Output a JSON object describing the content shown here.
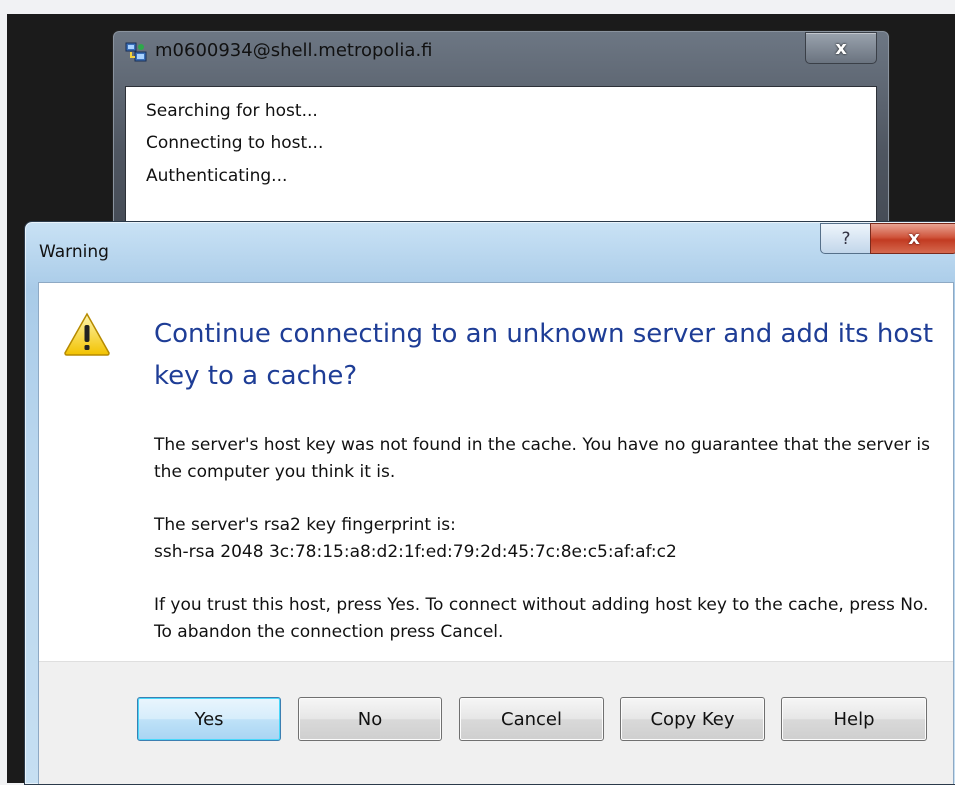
{
  "background_window": {
    "title": "m0600934@shell.metropolia.fi",
    "close_label": "x",
    "icon": "putty-icon",
    "lines": [
      "Searching for host...",
      "Connecting to host...",
      "Authenticating..."
    ]
  },
  "dialog": {
    "title": "Warning",
    "help_label": "?",
    "close_label": "x",
    "icon": "warning-icon",
    "headline": "Continue connecting to an unknown server and add its host key to a cache?",
    "paragraph1": "The server's host key was not found in the cache. You have no guarantee that the server is the computer you think it is.",
    "fingerprint_label": "The server's rsa2 key fingerprint is:",
    "fingerprint_value": "ssh-rsa 2048 3c:78:15:a8:d2:1f:ed:79:2d:45:7c:8e:c5:af:af:c2",
    "paragraph3": "If you trust this host, press Yes. To connect without adding host key to the cache, press No. To abandon the connection press Cancel.",
    "buttons": {
      "yes": "Yes",
      "no": "No",
      "cancel": "Cancel",
      "copy_key": "Copy Key",
      "help": "Help"
    }
  },
  "colors": {
    "headline": "#1e3d96",
    "close_button": "#c23b22",
    "default_button_border": "#3c7fb1"
  }
}
